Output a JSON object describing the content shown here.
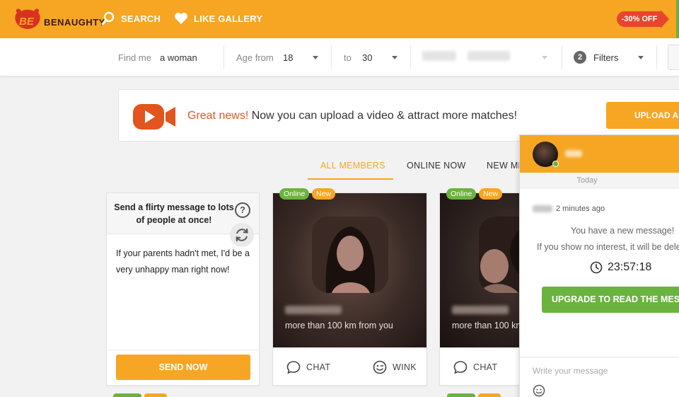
{
  "brand": {
    "name": "BENAUGHTY"
  },
  "nav": {
    "search_label": "SEARCH",
    "like_gallery_label": "LIKE GALLERY",
    "discount_label": "-30% OFF"
  },
  "filters": {
    "find_me_label": "Find me",
    "find_me_value": "a woman",
    "age_from_label": "Age from",
    "age_from_value": "18",
    "age_to_label": "to",
    "age_to_value": "30",
    "filters_count": "2",
    "filters_label": "Filters"
  },
  "banner": {
    "highlight": "Great news!",
    "text": "Now you can upload a video & attract more matches!",
    "button_label": "UPLOAD A"
  },
  "tabs": [
    {
      "label": "ALL MEMBERS",
      "active": true
    },
    {
      "label": "ONLINE NOW",
      "active": false
    },
    {
      "label": "NEW ME",
      "active": false
    }
  ],
  "message_card": {
    "title": "Send a flirty message to lots of people at once!",
    "help_glyph": "?",
    "message": "If your parents hadn't met, I'd be a very unhappy man right now!",
    "send_label": "SEND NOW"
  },
  "members": [
    {
      "online_badge": "Online",
      "new_badge": "New",
      "distance": "more than 100 km from you",
      "chat_label": "CHAT",
      "wink_label": "WINK"
    },
    {
      "online_badge": "Online",
      "new_badge": "New",
      "distance": "more than 100 km",
      "chat_label": "CHAT"
    }
  ],
  "chat": {
    "day_label": "Today",
    "time_ago": "2 minutes ago",
    "line1": "You have a new message!",
    "line2": "If you show no interest, it will be dele",
    "countdown": "23:57:18",
    "upgrade_label": "UPGRADE TO READ THE MESSA",
    "input_placeholder": "Write your message"
  },
  "colors": {
    "brand_orange": "#f6a623",
    "online_green": "#6ab33f",
    "discount_red": "#e8452c",
    "highlight_red": "#e2551e"
  }
}
